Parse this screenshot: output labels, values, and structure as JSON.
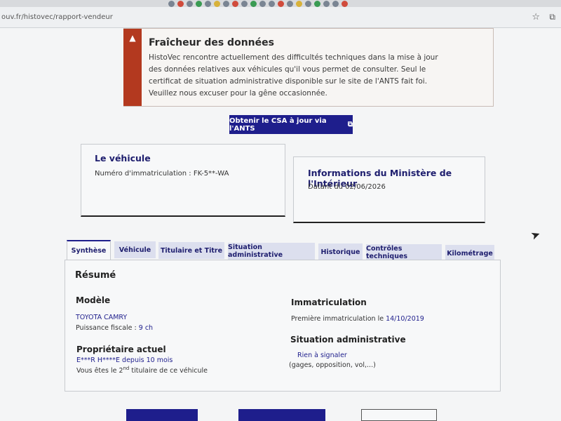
{
  "browser": {
    "url": "ouv.fr/histovec/rapport-vendeur"
  },
  "alert": {
    "title": "Fraîcheur des données",
    "text": "HistoVec rencontre actuellement des difficultés techniques dans la mise à jour des données relatives aux véhicules qu'il vous permet de consulter. Seul le certificat de situation administrative disponible sur le site de l'ANTS fait foi. Veuillez nous excuser pour la gêne occasionnée."
  },
  "csa_button": "Obtenir le CSA à jour via l'ANTS",
  "vehicle_card": {
    "title": "Le véhicule",
    "plate_label": "Numéro d'immatriculation : FK-5**-WA"
  },
  "ministry_card": {
    "title": "Informations du Ministère de l'Intérieur",
    "date": "Datant du 02/06/2026"
  },
  "tabs": [
    {
      "label": "Synthèse"
    },
    {
      "label": "Véhicule"
    },
    {
      "label": "Titulaire et Titre"
    },
    {
      "label": "Situation administrative"
    },
    {
      "label": "Historique"
    },
    {
      "label": "Contrôles techniques"
    },
    {
      "label": "Kilométrage"
    }
  ],
  "summary": {
    "heading": "Résumé",
    "model_heading": "Modèle",
    "model": "TOYOTA CAMRY",
    "power_label": "Puissance fiscale : ",
    "power_value": "9 ch",
    "owner_heading": "Propriétaire actuel",
    "owner_name": "E***R H****E",
    "owner_since_label": " depuis ",
    "owner_since_value": "10 mois",
    "owner_rank_prefix": "Vous êtes le 2",
    "owner_rank_sup": "nd",
    "owner_rank_suffix": " titulaire de ce véhicule",
    "registration_heading": "Immatriculation",
    "first_registration_label": "Première immatriculation le ",
    "first_registration_date": "14/10/2019",
    "admin_heading": "Situation administrative",
    "admin_status": "Rien à signaler",
    "admin_detail": "(gages, opposition, vol,...)"
  },
  "colors": {
    "primary": "#1e1e8c",
    "alert_red": "#b3391f",
    "tab_bg": "#dcdfee"
  }
}
